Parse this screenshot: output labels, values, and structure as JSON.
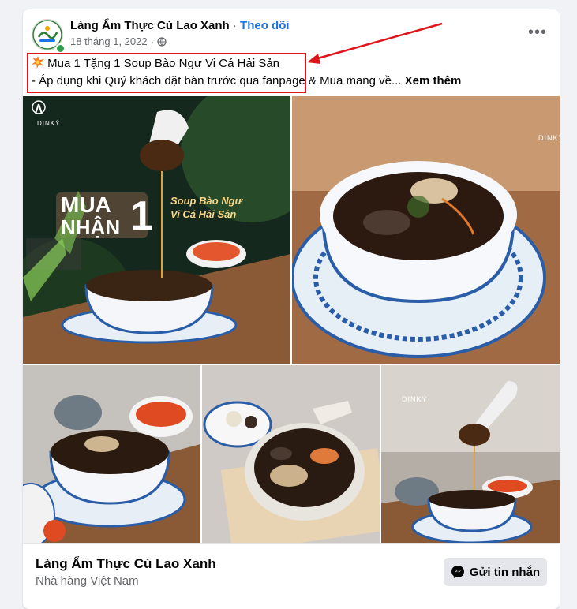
{
  "post": {
    "page_name": "Làng Ẩm Thực Cù Lao Xanh",
    "separator": "·",
    "follow_label": "Theo dõi",
    "date": "18 tháng 1, 2022",
    "date_separator": "·",
    "more_label": "•••",
    "text_line1": "Mua 1 Tặng 1 Soup Bào Ngư Vi Cá Hải Sản",
    "text_line2": "- Áp dụng khi Quý khách đặt bàn trước qua fanpage & Mua mang về...",
    "see_more_label": "Xem thêm"
  },
  "photos": {
    "promo_big": "MUA",
    "promo_small": "NHẬN",
    "promo_number": "1",
    "promo_caption_1": "Soup Bào Ngư",
    "promo_caption_2": "Vi Cá Hải Sản",
    "brand": "DỊNKÝ"
  },
  "footer": {
    "page_name": "Làng Ẩm Thực Cù Lao Xanh",
    "category": "Nhà hàng Việt Nam",
    "message_button": "Gửi tin nhắn"
  },
  "colors": {
    "follow": "#1b74e4",
    "highlight": "#e0141b",
    "online": "#31a24c"
  }
}
